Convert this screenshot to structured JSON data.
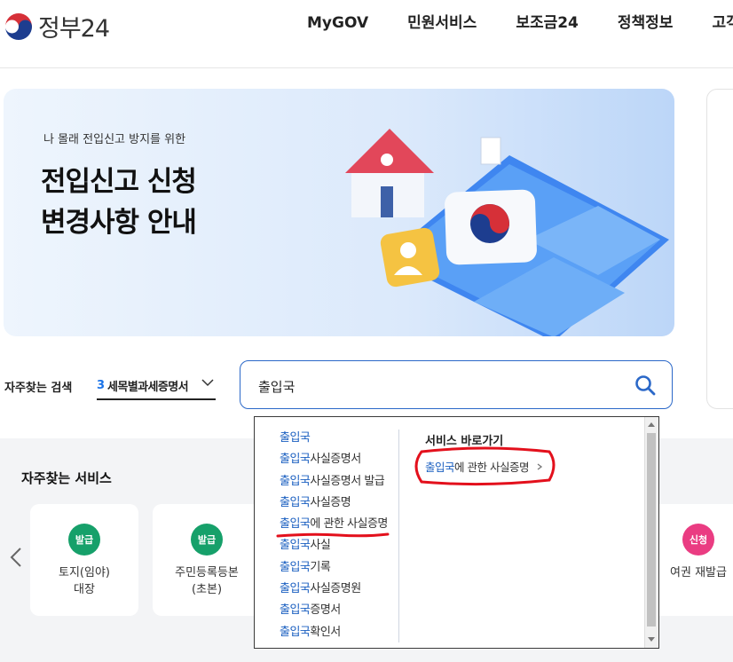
{
  "header": {
    "logo_text": "정부24",
    "nav": [
      "MyGOV",
      "민원서비스",
      "보조금24",
      "정책정보",
      "고객센터"
    ]
  },
  "banner": {
    "subtitle": "나 몰래 전입신고 방지를 위한",
    "title": "전입신고 신청\n변경사항 안내"
  },
  "search": {
    "popular_label": "자주찾는 검색",
    "popular_rank": "3",
    "popular_keyword": "세목별과세증명서",
    "query": "출입국"
  },
  "autocomplete": {
    "highlight": "출입국",
    "suggestions": [
      {
        "prefix": "출입국",
        "suffix": ""
      },
      {
        "prefix": "출입국",
        "suffix": "사실증명서"
      },
      {
        "prefix": "출입국",
        "suffix": "사실증명서 발급"
      },
      {
        "prefix": "출입국",
        "suffix": "사실증명"
      },
      {
        "prefix": "출입국",
        "suffix": "에 관한 사실증명"
      },
      {
        "prefix": "출입국",
        "suffix": "사실"
      },
      {
        "prefix": "출입국",
        "suffix": "기록"
      },
      {
        "prefix": "출입국",
        "suffix": "사실증명원"
      },
      {
        "prefix": "출입국",
        "suffix": "증명서"
      },
      {
        "prefix": "출입국",
        "suffix": "확인서"
      }
    ],
    "shortcut_title": "서비스 바로가기",
    "shortcut": {
      "prefix": "출입국",
      "suffix": "에 관한 사실증명"
    }
  },
  "services": {
    "title": "자주찾는 서비스",
    "cards": [
      {
        "badge": "발급",
        "label": "토지(임야)\n대장",
        "color": "#16a06a"
      },
      {
        "badge": "발급",
        "label": "주민등록등본\n(초본)",
        "color": "#16a06a"
      },
      {
        "badge": "신청",
        "label": "여권 재발급",
        "color": "#ea3c82"
      }
    ]
  },
  "colors": {
    "accent": "#1a5fc0",
    "annotation": "#e3101c"
  }
}
